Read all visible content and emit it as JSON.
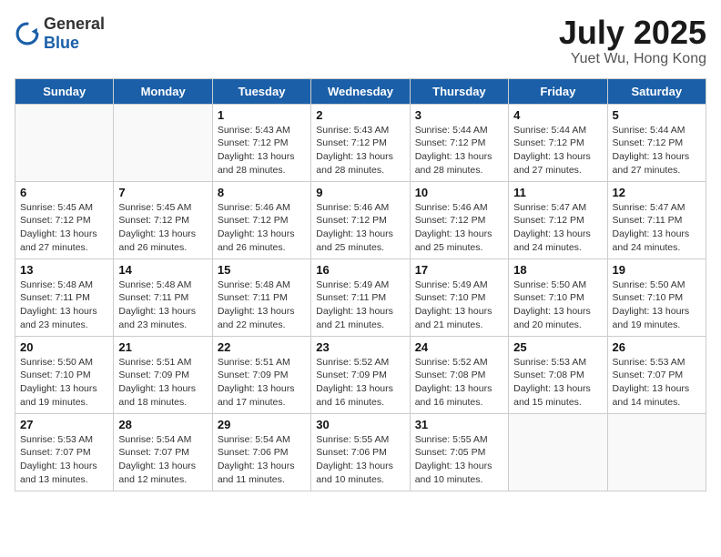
{
  "logo": {
    "general": "General",
    "blue": "Blue"
  },
  "title": "July 2025",
  "subtitle": "Yuet Wu, Hong Kong",
  "days_header": [
    "Sunday",
    "Monday",
    "Tuesday",
    "Wednesday",
    "Thursday",
    "Friday",
    "Saturday"
  ],
  "weeks": [
    [
      {
        "day": "",
        "info": ""
      },
      {
        "day": "",
        "info": ""
      },
      {
        "day": "1",
        "info": "Sunrise: 5:43 AM\nSunset: 7:12 PM\nDaylight: 13 hours\nand 28 minutes."
      },
      {
        "day": "2",
        "info": "Sunrise: 5:43 AM\nSunset: 7:12 PM\nDaylight: 13 hours\nand 28 minutes."
      },
      {
        "day": "3",
        "info": "Sunrise: 5:44 AM\nSunset: 7:12 PM\nDaylight: 13 hours\nand 28 minutes."
      },
      {
        "day": "4",
        "info": "Sunrise: 5:44 AM\nSunset: 7:12 PM\nDaylight: 13 hours\nand 27 minutes."
      },
      {
        "day": "5",
        "info": "Sunrise: 5:44 AM\nSunset: 7:12 PM\nDaylight: 13 hours\nand 27 minutes."
      }
    ],
    [
      {
        "day": "6",
        "info": "Sunrise: 5:45 AM\nSunset: 7:12 PM\nDaylight: 13 hours\nand 27 minutes."
      },
      {
        "day": "7",
        "info": "Sunrise: 5:45 AM\nSunset: 7:12 PM\nDaylight: 13 hours\nand 26 minutes."
      },
      {
        "day": "8",
        "info": "Sunrise: 5:46 AM\nSunset: 7:12 PM\nDaylight: 13 hours\nand 26 minutes."
      },
      {
        "day": "9",
        "info": "Sunrise: 5:46 AM\nSunset: 7:12 PM\nDaylight: 13 hours\nand 25 minutes."
      },
      {
        "day": "10",
        "info": "Sunrise: 5:46 AM\nSunset: 7:12 PM\nDaylight: 13 hours\nand 25 minutes."
      },
      {
        "day": "11",
        "info": "Sunrise: 5:47 AM\nSunset: 7:12 PM\nDaylight: 13 hours\nand 24 minutes."
      },
      {
        "day": "12",
        "info": "Sunrise: 5:47 AM\nSunset: 7:11 PM\nDaylight: 13 hours\nand 24 minutes."
      }
    ],
    [
      {
        "day": "13",
        "info": "Sunrise: 5:48 AM\nSunset: 7:11 PM\nDaylight: 13 hours\nand 23 minutes."
      },
      {
        "day": "14",
        "info": "Sunrise: 5:48 AM\nSunset: 7:11 PM\nDaylight: 13 hours\nand 23 minutes."
      },
      {
        "day": "15",
        "info": "Sunrise: 5:48 AM\nSunset: 7:11 PM\nDaylight: 13 hours\nand 22 minutes."
      },
      {
        "day": "16",
        "info": "Sunrise: 5:49 AM\nSunset: 7:11 PM\nDaylight: 13 hours\nand 21 minutes."
      },
      {
        "day": "17",
        "info": "Sunrise: 5:49 AM\nSunset: 7:10 PM\nDaylight: 13 hours\nand 21 minutes."
      },
      {
        "day": "18",
        "info": "Sunrise: 5:50 AM\nSunset: 7:10 PM\nDaylight: 13 hours\nand 20 minutes."
      },
      {
        "day": "19",
        "info": "Sunrise: 5:50 AM\nSunset: 7:10 PM\nDaylight: 13 hours\nand 19 minutes."
      }
    ],
    [
      {
        "day": "20",
        "info": "Sunrise: 5:50 AM\nSunset: 7:10 PM\nDaylight: 13 hours\nand 19 minutes."
      },
      {
        "day": "21",
        "info": "Sunrise: 5:51 AM\nSunset: 7:09 PM\nDaylight: 13 hours\nand 18 minutes."
      },
      {
        "day": "22",
        "info": "Sunrise: 5:51 AM\nSunset: 7:09 PM\nDaylight: 13 hours\nand 17 minutes."
      },
      {
        "day": "23",
        "info": "Sunrise: 5:52 AM\nSunset: 7:09 PM\nDaylight: 13 hours\nand 16 minutes."
      },
      {
        "day": "24",
        "info": "Sunrise: 5:52 AM\nSunset: 7:08 PM\nDaylight: 13 hours\nand 16 minutes."
      },
      {
        "day": "25",
        "info": "Sunrise: 5:53 AM\nSunset: 7:08 PM\nDaylight: 13 hours\nand 15 minutes."
      },
      {
        "day": "26",
        "info": "Sunrise: 5:53 AM\nSunset: 7:07 PM\nDaylight: 13 hours\nand 14 minutes."
      }
    ],
    [
      {
        "day": "27",
        "info": "Sunrise: 5:53 AM\nSunset: 7:07 PM\nDaylight: 13 hours\nand 13 minutes."
      },
      {
        "day": "28",
        "info": "Sunrise: 5:54 AM\nSunset: 7:07 PM\nDaylight: 13 hours\nand 12 minutes."
      },
      {
        "day": "29",
        "info": "Sunrise: 5:54 AM\nSunset: 7:06 PM\nDaylight: 13 hours\nand 11 minutes."
      },
      {
        "day": "30",
        "info": "Sunrise: 5:55 AM\nSunset: 7:06 PM\nDaylight: 13 hours\nand 10 minutes."
      },
      {
        "day": "31",
        "info": "Sunrise: 5:55 AM\nSunset: 7:05 PM\nDaylight: 13 hours\nand 10 minutes."
      },
      {
        "day": "",
        "info": ""
      },
      {
        "day": "",
        "info": ""
      }
    ]
  ]
}
